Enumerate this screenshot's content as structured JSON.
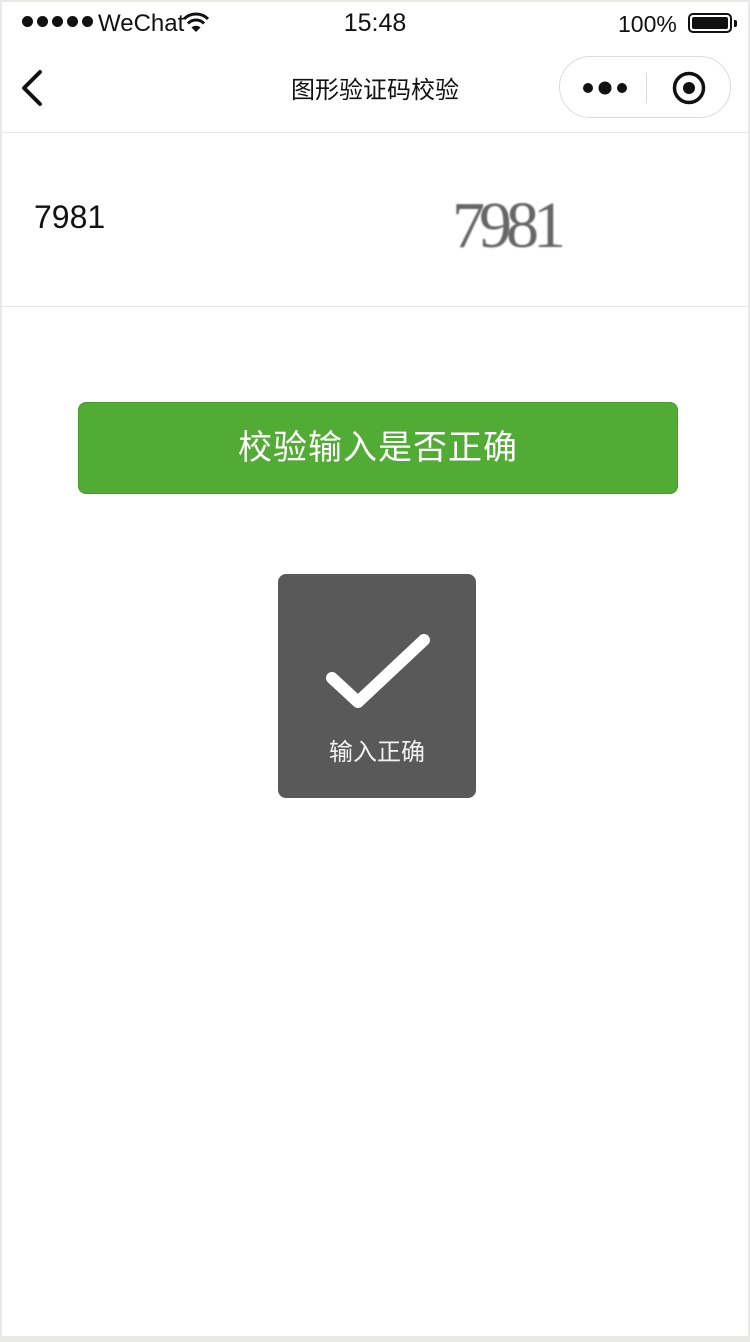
{
  "status_bar": {
    "carrier": "WeChat",
    "time": "15:48",
    "battery": "100%",
    "battery_level": 1.0
  },
  "nav": {
    "title": "图形验证码校验",
    "back_icon": "chevron-left-icon",
    "more_icon": "more-dots-icon",
    "close_icon": "target-circle-icon"
  },
  "form": {
    "input_value": "7981",
    "captcha_text": "7981"
  },
  "verify_button": {
    "label": "校验输入是否正确",
    "color": "#52ab35"
  },
  "toast": {
    "icon": "checkmark-icon",
    "message": "输入正确",
    "background": "#595959"
  }
}
